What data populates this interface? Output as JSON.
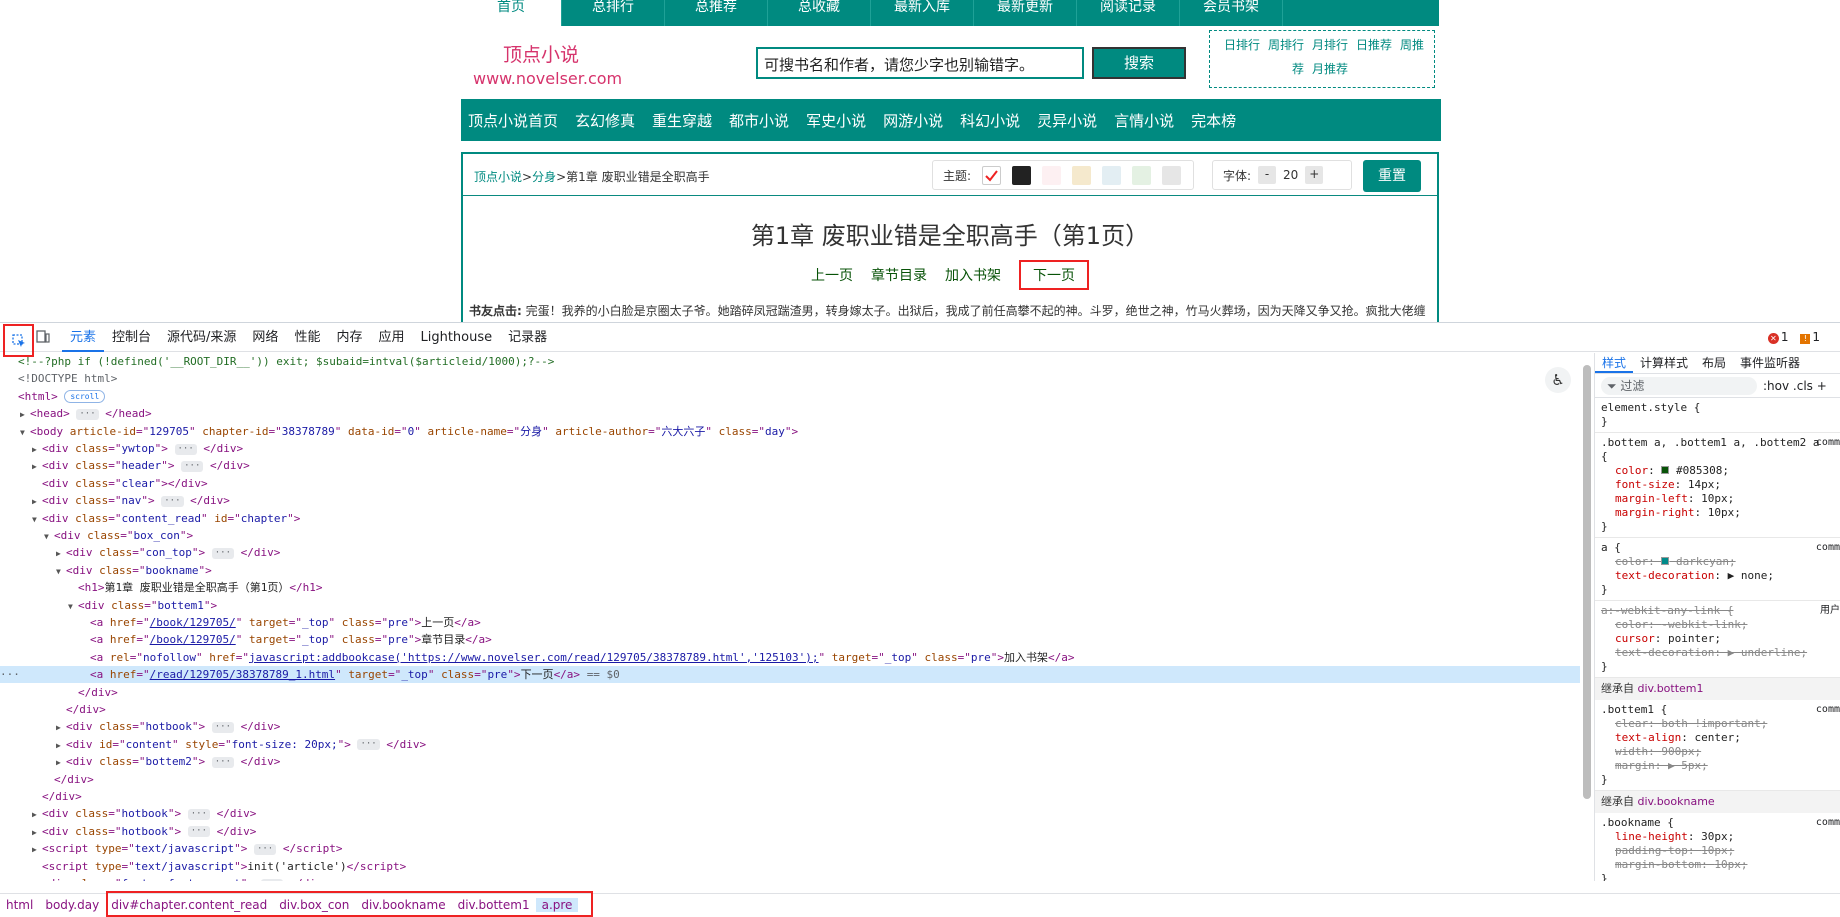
{
  "site": {
    "topnav": [
      "首页",
      "总排行",
      "总推荐",
      "总收藏",
      "最新入库",
      "最新更新",
      "阅读记录",
      "会员书架"
    ],
    "logo_name": "顶点小说",
    "logo_url": "www.novelser.com",
    "search_placeholder": "可搜书名和作者，请您少字也别输错字。",
    "search_button": "搜索",
    "ranks": [
      "日排行",
      "周排行",
      "月排行",
      "日推荐",
      "周推荐",
      "月推荐"
    ],
    "categories": [
      "顶点小说首页",
      "玄幻修真",
      "重生穿越",
      "都市小说",
      "军史小说",
      "网游小说",
      "科幻小说",
      "灵异小说",
      "言情小说",
      "完本榜"
    ],
    "breadcrumb": [
      "顶点小说",
      ">",
      "分身",
      ">",
      "第1章 废职业错是全职高手"
    ],
    "theme_label": "主题:",
    "theme_colors": [
      "#ffffff",
      "#222222",
      "#fdf0f2",
      "#f5e9cd",
      "#e3eef3",
      "#e4f1e3",
      "#e6e6e6"
    ],
    "font_label": "字体:",
    "font_minus": "-",
    "font_size": "20",
    "font_plus": "+",
    "reset": "重置",
    "chapter_title": "第1章  废职业错是全职高手（第1页）",
    "links": [
      "上一页",
      "章节目录",
      "加入书架",
      "下一页"
    ],
    "intro_label": "书友点击:",
    "intro_text": "完蛋！我养的小白脸是京圈太子爷。她踏碎凤冠踹渣男，转身嫁太子。出狱后，我成了前任高攀不起的神。斗罗，绝世之神，竹马火葬场，因为天降又争又抢。疯批大佬缠"
  },
  "devtools": {
    "tabs": [
      "元素",
      "控制台",
      "源代码/来源",
      "网络",
      "性能",
      "内存",
      "应用",
      "Lighthouse",
      "记录器"
    ],
    "errors": "1",
    "warnings": "1",
    "dom": [
      {
        "indent": 0,
        "tri": "",
        "html": "<span class='cm'>&lt;!--?php if (!defined('__ROOT_DIR__')) exit; $subaid=intval($articleid/1000);?--&gt;</span>"
      },
      {
        "indent": 0,
        "tri": "",
        "html": "<span style='color:#5f6368'>&lt;!DOCTYPE html&gt;</span>"
      },
      {
        "indent": 0,
        "tri": "",
        "html": "&lt;html&gt; <span class='pill'>scroll</span>"
      },
      {
        "indent": 1,
        "tri": "▶",
        "html": "&lt;head&gt; <span class='dots'>···</span> &lt;/head&gt;"
      },
      {
        "indent": 1,
        "tri": "▼",
        "html": "&lt;body <span class='at'>article-id</span>=\"<span class='av'>129705</span>\" <span class='at'>chapter-id</span>=\"<span class='av'>38378789</span>\" <span class='at'>data-id</span>=\"<span class='av'>0</span>\" <span class='at'>article-name</span>=\"<span class='av'>分身</span>\" <span class='at'>article-author</span>=\"<span class='av'>六大六子</span>\" <span class='at'>class</span>=\"<span class='av'>day</span>\"&gt;"
      },
      {
        "indent": 2,
        "tri": "▶",
        "html": "&lt;div <span class='at'>class</span>=\"<span class='av'>ywtop</span>\"&gt; <span class='dots'>···</span> &lt;/div&gt;"
      },
      {
        "indent": 2,
        "tri": "▶",
        "html": "&lt;div <span class='at'>class</span>=\"<span class='av'>header</span>\"&gt; <span class='dots'>···</span> &lt;/div&gt;"
      },
      {
        "indent": 2,
        "tri": "",
        "html": "&lt;div <span class='at'>class</span>=\"<span class='av'>clear</span>\"&gt;&lt;/div&gt;"
      },
      {
        "indent": 2,
        "tri": "▶",
        "html": "&lt;div <span class='at'>class</span>=\"<span class='av'>nav</span>\"&gt; <span class='dots'>···</span> &lt;/div&gt;"
      },
      {
        "indent": 2,
        "tri": "▼",
        "html": "&lt;div <span class='at'>class</span>=\"<span class='av'>content_read</span>\" <span class='at'>id</span>=\"<span class='av'>chapter</span>\"&gt;"
      },
      {
        "indent": 3,
        "tri": "▼",
        "html": "&lt;div <span class='at'>class</span>=\"<span class='av'>box_con</span>\"&gt;"
      },
      {
        "indent": 4,
        "tri": "▶",
        "html": "&lt;div <span class='at'>class</span>=\"<span class='av'>con_top</span>\"&gt; <span class='dots'>···</span> &lt;/div&gt;"
      },
      {
        "indent": 4,
        "tri": "▼",
        "html": "&lt;div <span class='at'>class</span>=\"<span class='av'>bookname</span>\"&gt;"
      },
      {
        "indent": 5,
        "tri": "",
        "html": "&lt;h1&gt;<span class='txt'>第1章 废职业错是全职高手（第1页）</span>&lt;/h1&gt;"
      },
      {
        "indent": 5,
        "tri": "▼",
        "html": "&lt;div <span class='at'>class</span>=\"<span class='av'>bottem1</span>\"&gt;"
      },
      {
        "indent": 6,
        "tri": "",
        "html": "&lt;a <span class='at'>href</span>=\"<span class='lnk'>/book/129705/</span>\" <span class='at'>target</span>=\"<span class='av'>_top</span>\" <span class='at'>class</span>=\"<span class='av'>pre</span>\"&gt;<span class='txt'>上一页</span>&lt;/a&gt;"
      },
      {
        "indent": 6,
        "tri": "",
        "html": "&lt;a <span class='at'>href</span>=\"<span class='lnk'>/book/129705/</span>\" <span class='at'>target</span>=\"<span class='av'>_top</span>\" <span class='at'>class</span>=\"<span class='av'>pre</span>\"&gt;<span class='txt'>章节目录</span>&lt;/a&gt;"
      },
      {
        "indent": 6,
        "tri": "",
        "html": "&lt;a <span class='at'>rel</span>=\"<span class='av'>nofollow</span>\" <span class='at'>href</span>=\"<span class='lnk'>javascript:addbookcase('https://www.novelser.com/read/129705/38378789.html','125103');</span>\" <span class='at'>target</span>=\"<span class='av'>_top</span>\" <span class='at'>class</span>=\"<span class='av'>pre</span>\"&gt;<span class='txt'>加入书架</span>&lt;/a&gt;"
      },
      {
        "indent": 6,
        "tri": "",
        "hl": true,
        "html": "&lt;a <span class='at'>href</span>=\"<span class='lnk'>/read/129705/38378789_1.html</span>\" <span class='at'>target</span>=\"<span class='av'>_top</span>\" <span class='at'>class</span>=\"<span class='av'>pre</span>\"&gt;<span class='txt'>下一页</span>&lt;/a&gt; <span style='color:#5f6368'>== $0</span>"
      },
      {
        "indent": 5,
        "tri": "",
        "html": "&lt;/div&gt;"
      },
      {
        "indent": 4,
        "tri": "",
        "html": "&lt;/div&gt;"
      },
      {
        "indent": 4,
        "tri": "▶",
        "html": "&lt;div <span class='at'>class</span>=\"<span class='av'>hotbook</span>\"&gt; <span class='dots'>···</span> &lt;/div&gt;"
      },
      {
        "indent": 4,
        "tri": "▶",
        "html": "&lt;div <span class='at'>id</span>=\"<span class='av'>content</span>\" <span class='at'>style</span>=\"<span class='av'>font-size: 20px;</span>\"&gt; <span class='dots'>···</span> &lt;/div&gt;"
      },
      {
        "indent": 4,
        "tri": "▶",
        "html": "&lt;div <span class='at'>class</span>=\"<span class='av'>bottem2</span>\"&gt; <span class='dots'>···</span> &lt;/div&gt;"
      },
      {
        "indent": 3,
        "tri": "",
        "html": "&lt;/div&gt;"
      },
      {
        "indent": 2,
        "tri": "",
        "html": "&lt;/div&gt;"
      },
      {
        "indent": 2,
        "tri": "▶",
        "html": "&lt;div <span class='at'>class</span>=\"<span class='av'>hotbook</span>\"&gt; <span class='dots'>···</span> &lt;/div&gt;"
      },
      {
        "indent": 2,
        "tri": "▶",
        "html": "&lt;div <span class='at'>class</span>=\"<span class='av'>hotbook</span>\"&gt; <span class='dots'>···</span> &lt;/div&gt;"
      },
      {
        "indent": 2,
        "tri": "▶",
        "html": "&lt;script <span class='at'>type</span>=\"<span class='av'>text/javascript</span>\"&gt; <span class='dots'>···</span> &lt;/script&gt;"
      },
      {
        "indent": 2,
        "tri": "",
        "html": "&lt;script <span class='at'>type</span>=\"<span class='av'>text/javascript</span>\"&gt;<span class='txt'>init('article')</span>&lt;/script&gt;"
      },
      {
        "indent": 2,
        "tri": "▶",
        "html": "&lt;div <span class='at'>class</span>=\"<span class='av'>footer footer_cont</span>\"&gt; <span class='dots'>···</span> &lt;/div&gt;"
      }
    ],
    "style_tabs": [
      "样式",
      "计算样式",
      "布局",
      "事件监听器"
    ],
    "filter_placeholder": "过滤",
    "filter_opts": ":hov  .cls  +",
    "crumbs": [
      "html",
      "body.day",
      "div#chapter.content_read",
      "div.box_con",
      "div.bookname",
      "div.bottem1",
      "a.pre"
    ]
  }
}
